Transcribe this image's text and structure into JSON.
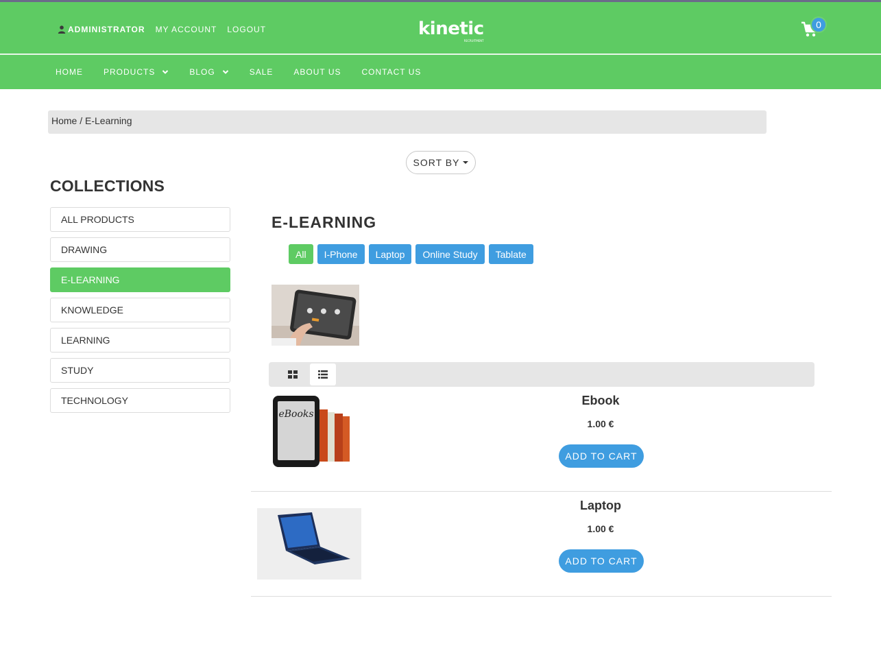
{
  "header": {
    "user": "ADMINISTRATOR",
    "my_account": "MY ACCOUNT",
    "logout": "LOGOUT",
    "logo": "kinetic",
    "logo_sub": "RECRUITMENT",
    "cart_count": "0"
  },
  "nav": {
    "items": [
      {
        "label": "HOME"
      },
      {
        "label": "PRODUCTS"
      },
      {
        "label": "BLOG"
      },
      {
        "label": "SALE"
      },
      {
        "label": "ABOUT US"
      },
      {
        "label": "CONTACT US"
      }
    ]
  },
  "breadcrumb": "Home / E-Learning",
  "sort_by": "SORT BY",
  "collections": {
    "title": "COLLECTIONS",
    "items": [
      {
        "label": "ALL PRODUCTS"
      },
      {
        "label": "DRAWING"
      },
      {
        "label": "E-LEARNING"
      },
      {
        "label": "KNOWLEDGE"
      },
      {
        "label": "LEARNING"
      },
      {
        "label": "STUDY"
      },
      {
        "label": "TECHNOLOGY"
      }
    ]
  },
  "section": {
    "title": "E-LEARNING",
    "filters": [
      {
        "label": "All"
      },
      {
        "label": "I-Phone"
      },
      {
        "label": "Laptop"
      },
      {
        "label": "Online Study"
      },
      {
        "label": "Tablate"
      }
    ]
  },
  "products": [
    {
      "name": "Ebook",
      "price": "1.00 €",
      "button": "ADD TO CART",
      "image_text": "eBooks"
    },
    {
      "name": "Laptop",
      "price": "1.00 €",
      "button": "ADD TO CART"
    }
  ],
  "colors": {
    "brand_green": "#5ecb63",
    "accent_blue": "#3f9de0"
  }
}
